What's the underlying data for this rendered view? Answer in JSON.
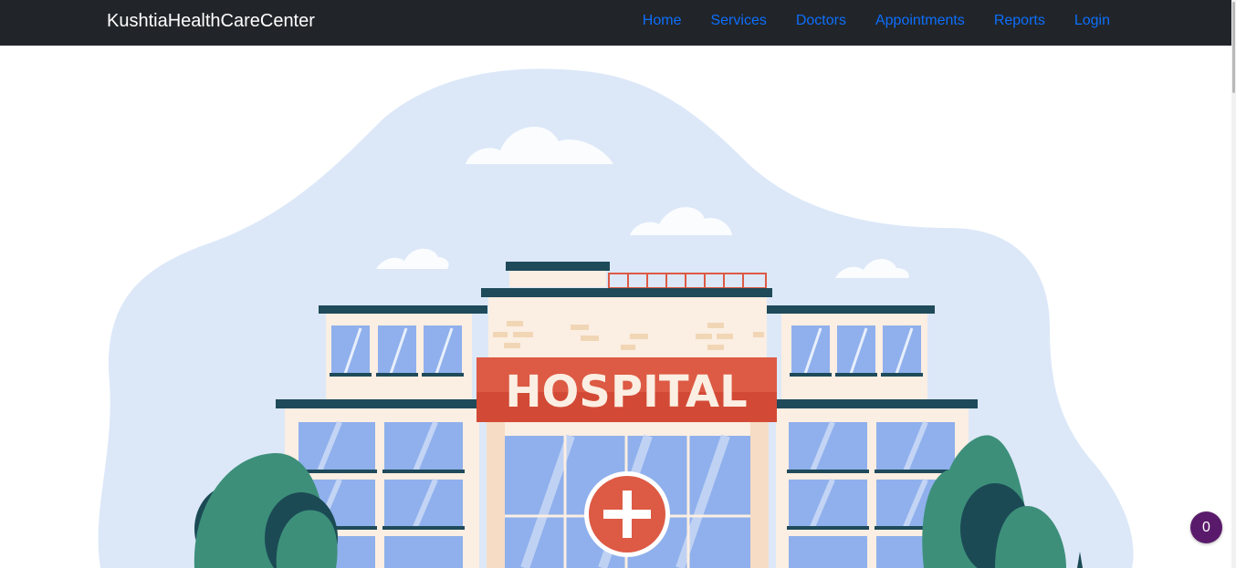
{
  "navbar": {
    "brand": "KushtiaHealthCareCenter",
    "links": [
      {
        "label": "Home"
      },
      {
        "label": "Services"
      },
      {
        "label": "Doctors"
      },
      {
        "label": "Appointments"
      },
      {
        "label": "Reports"
      },
      {
        "label": "Login"
      }
    ],
    "background_color": "#212529",
    "link_color": "#0d6efd"
  },
  "hero": {
    "sign_text": "HOSPITAL",
    "sky_color": "#dce8f8",
    "sign_color": "#dd5a44",
    "glass_color": "#8fb0ec",
    "tree_color": "#3d8f7a"
  },
  "floating_badge": {
    "count": "0",
    "color": "#5a1a6b"
  }
}
